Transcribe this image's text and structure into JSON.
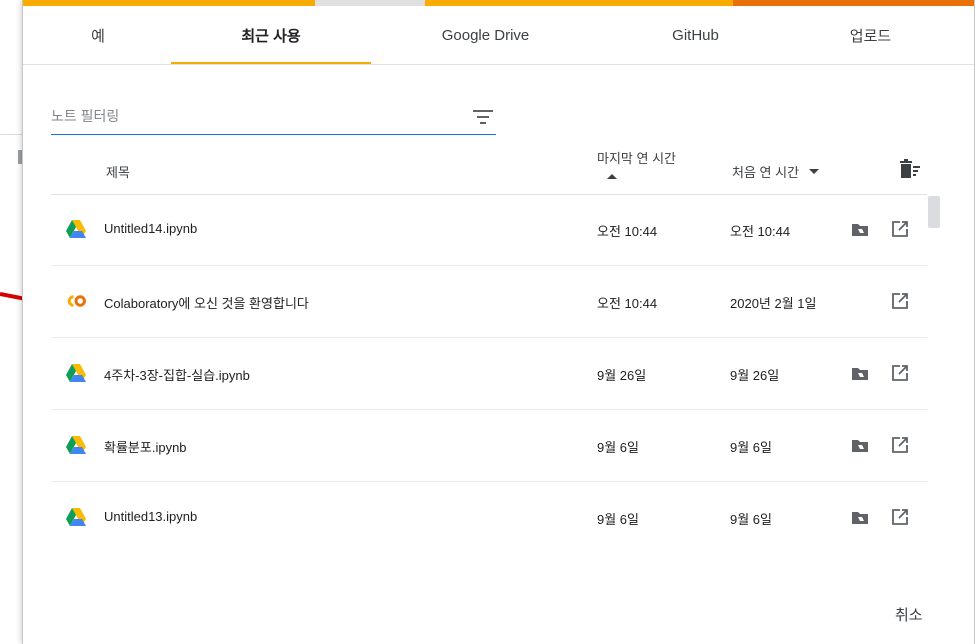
{
  "tabs": [
    {
      "label": "예"
    },
    {
      "label": "최근 사용"
    },
    {
      "label": "Google Drive"
    },
    {
      "label": "GitHub"
    },
    {
      "label": "업로드"
    }
  ],
  "filter": {
    "placeholder": "노트 필터링",
    "value": ""
  },
  "table_headers": {
    "title": "제목",
    "last_opened": "마지막 연 시간",
    "first_opened": "처음 연 시간"
  },
  "rows": [
    {
      "name": "Untitled14.ipynb",
      "last": "오전 10:44",
      "first": "오전 10:44",
      "icon": "google-drive-icon"
    },
    {
      "name": "Colaboratory에 오신 것을 환영합니다",
      "last": "오전 10:44",
      "first": "2020년 2월 1일",
      "icon": "colab-icon"
    },
    {
      "name": "4주차-3장-집합-실습.ipynb",
      "last": "9월 26일",
      "first": "9월 26일",
      "icon": "google-drive-icon"
    },
    {
      "name": "확률분포.ipynb",
      "last": "9월 6일",
      "first": "9월 6일",
      "icon": "google-drive-icon"
    },
    {
      "name": "Untitled13.ipynb",
      "last": "9월 6일",
      "first": "9월 6일",
      "icon": "google-drive-icon"
    }
  ],
  "footer": {
    "cancel": "취소"
  },
  "colors": {
    "accent": "#f9ab00",
    "accent2": "#e8710a",
    "focus": "#1a73e8",
    "annotation": "#d50000"
  }
}
